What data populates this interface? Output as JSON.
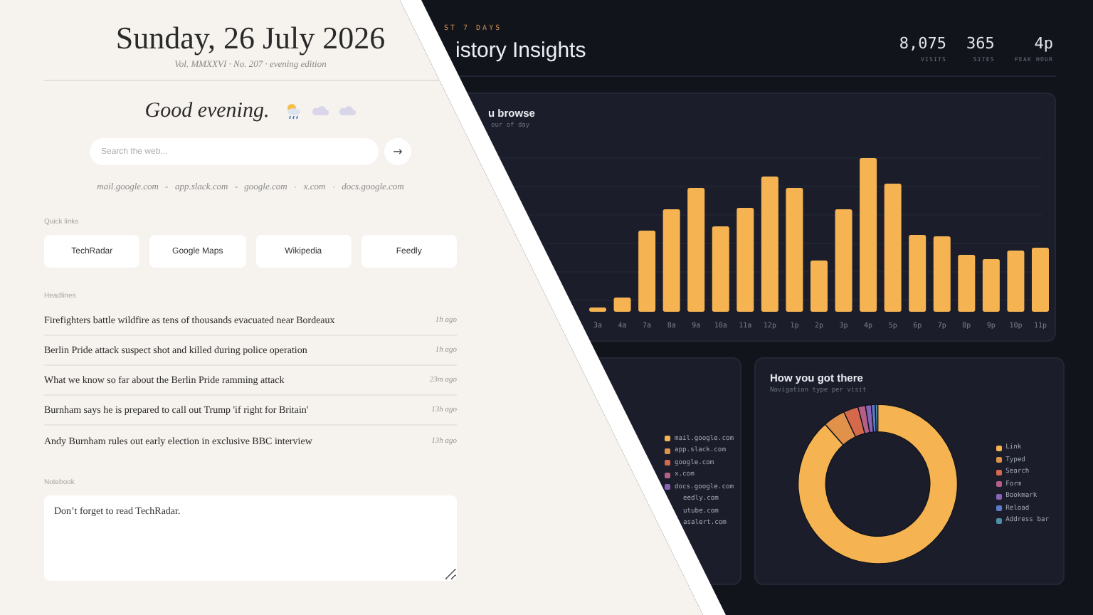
{
  "newtab": {
    "date": "Sunday, 26 July 2026",
    "edition": "Vol. MMXXVI · No. 207 · evening edition",
    "greeting": "Good evening.",
    "search": {
      "placeholder": "Search the web..."
    },
    "search_button": "→",
    "recent_sites": [
      "mail.google.com",
      "app.slack.com",
      "google.com",
      "x.com",
      "docs.google.com"
    ],
    "quick_links_label": "Quick links",
    "quick_links": [
      "TechRadar",
      "Google Maps",
      "Wikipedia",
      "Feedly"
    ],
    "headlines_label": "Headlines",
    "headlines": [
      {
        "title": "Firefighters battle wildfire as tens of thousands evacuated near Bordeaux",
        "age": "1h ago"
      },
      {
        "title": "Berlin Pride attack suspect shot and killed during police operation",
        "age": "1h ago"
      },
      {
        "title": "What we know so far about the Berlin Pride ramming attack",
        "age": "23m ago"
      },
      {
        "title": "Burnham says he is prepared to call out Trump 'if right for Britain'",
        "age": "13h ago"
      },
      {
        "title": "Andy Burnham rules out early election in exclusive BBC interview",
        "age": "13h ago"
      }
    ],
    "notebook_label": "Notebook",
    "notebook": {
      "value": "Don’t forget to read TechRadar."
    }
  },
  "dashboard": {
    "kicker": "ST 7 DAYS",
    "title": "istory Insights",
    "stats": [
      {
        "value": "8,075",
        "label": "VISITS"
      },
      {
        "value": "365",
        "label": "SITES"
      },
      {
        "value": "4p",
        "label": "PEAK HOUR"
      }
    ],
    "hours_card": {
      "title": "u browse",
      "subtitle": "our of day",
      "hour_labels": [
        "3a",
        "4a",
        "7a",
        "8a",
        "9a",
        "10a",
        "11a",
        "12p",
        "1p",
        "2p",
        "3p",
        "4p",
        "5p",
        "6p",
        "7p",
        "8p",
        "9p",
        "10p",
        "11p"
      ]
    },
    "sites_card": {
      "legend": [
        {
          "label": "mail.google.com",
          "color": "#f5b352"
        },
        {
          "label": "app.slack.com",
          "color": "#e0914a"
        },
        {
          "label": "google.com",
          "color": "#d4694c"
        },
        {
          "label": "x.com",
          "color": "#b35f86"
        },
        {
          "label": "docs.google.com",
          "color": "#8a62b8"
        },
        {
          "label": "eedly.com"
        },
        {
          "label": "utube.com"
        },
        {
          "label": "asalert.com"
        }
      ]
    },
    "navigation_card": {
      "title": "How you got there",
      "subtitle": "Navigation type per visit",
      "legend": [
        {
          "label": "Link",
          "color": "#f5b352"
        },
        {
          "label": "Typed",
          "color": "#e0914a"
        },
        {
          "label": "Search",
          "color": "#d4694c"
        },
        {
          "label": "Form",
          "color": "#b35f86"
        },
        {
          "label": "Bookmark",
          "color": "#8a62b8"
        },
        {
          "label": "Reload",
          "color": "#5c7bc9"
        },
        {
          "label": "Address bar",
          "color": "#4f8fa8"
        }
      ]
    }
  }
}
